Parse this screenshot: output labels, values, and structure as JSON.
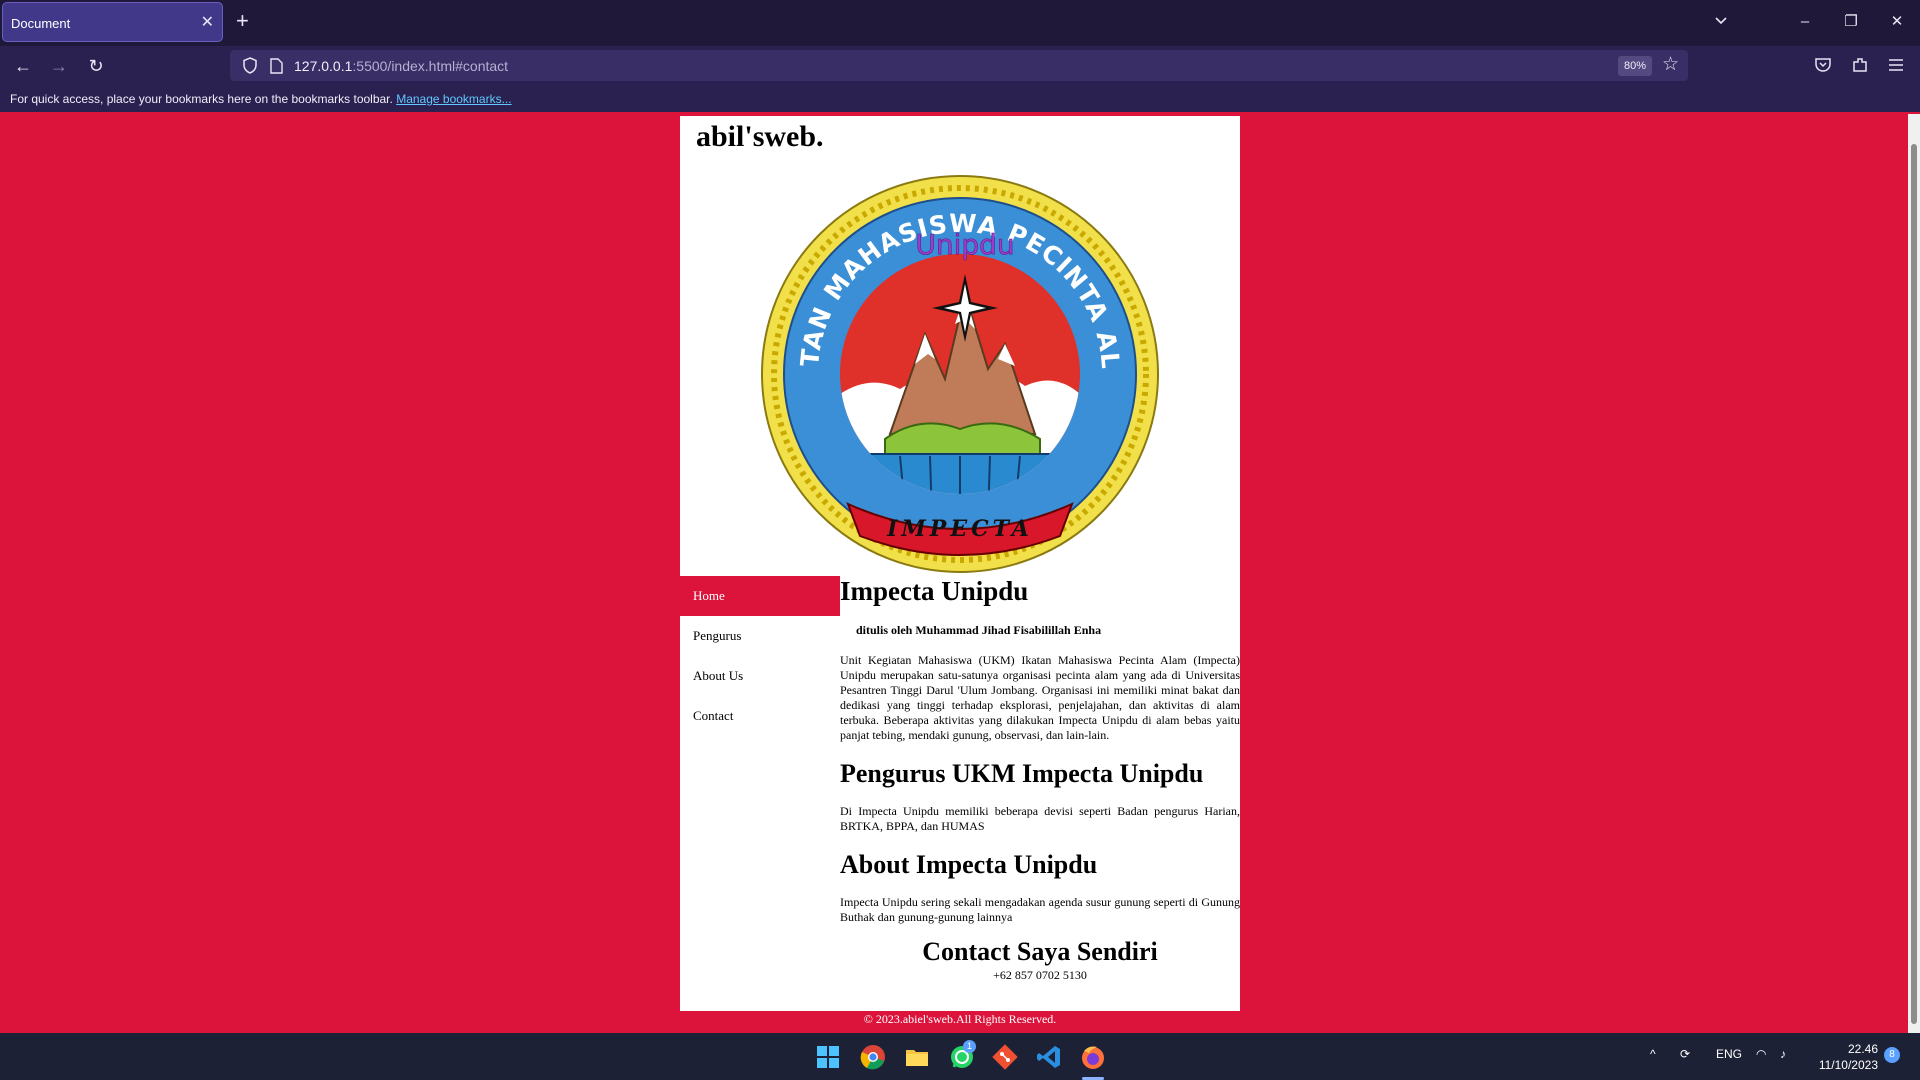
{
  "browser": {
    "tab_title": "Document",
    "tab_close_glyph": "✕",
    "new_tab_glyph": "+",
    "url_host": "127.0.0.1",
    "url_rest": ":5500/index.html#contact",
    "zoom": "80%",
    "bookmarks_text": "For quick access, place your bookmarks here on the bookmarks toolbar.",
    "bookmarks_link": "Manage bookmarks...",
    "icons": [
      "chevron-down-icon",
      "minimize-icon",
      "restore-icon",
      "close-icon",
      "back-icon",
      "forward-icon",
      "reload-icon",
      "shield-icon",
      "page-icon",
      "star-icon",
      "pocket-icon",
      "extensions-icon",
      "menu-icon"
    ]
  },
  "site": {
    "brand": "abil'sweb.",
    "logo": {
      "ring_text": "IKATAN MAHASISWA PECINTA ALAM",
      "subtitle": "Unipdu",
      "banner": "IMPECTA"
    },
    "nav": [
      {
        "label": "Home",
        "active": true
      },
      {
        "label": "Pengurus",
        "active": false
      },
      {
        "label": "About Us",
        "active": false
      },
      {
        "label": "Contact",
        "active": false
      }
    ],
    "section1": {
      "title": "Impecta Unipdu",
      "byline": "ditulis oleh Muhammad Jihad Fisabilillah Enha",
      "body": "Unit Kegiatan Mahasiswa (UKM) Ikatan Mahasiswa Pecinta Alam (Impecta) Unipdu merupakan satu-satunya organisasi pecinta alam yang ada di Universitas Pesantren Tinggi Darul 'Ulum Jombang. Organisasi ini memiliki minat bakat dan dedikasi yang tinggi terhadap eksplorasi, penjelajahan, dan aktivitas di alam terbuka. Beberapa aktivitas yang dilakukan Impecta Unipdu di alam bebas yaitu panjat tebing, mendaki gunung, observasi, dan lain-lain."
    },
    "section2": {
      "title": "Pengurus UKM Impecta Unipdu",
      "body": "Di Impecta Unipdu memiliki beberapa devisi seperti Badan pengurus Harian, BRTKA, BPPA, dan HUMAS"
    },
    "section3": {
      "title": "About Impecta Unipdu",
      "body": "Impecta Unipdu sering sekali mengadakan agenda susur gunung seperti di Gunung Buthak dan gunung-gunung lainnya"
    },
    "contact": {
      "title": "Contact Saya Sendiri",
      "phone": "+62 857 0702 5130"
    },
    "footer": "© 2023.abiel'sweb.All Rights Reserved.",
    "colors": {
      "background": "#dc143c",
      "active_nav": "#dc143c"
    }
  },
  "taskbar": {
    "apps": [
      "windows-start-icon",
      "chrome-icon",
      "file-explorer-icon",
      "whatsapp-icon",
      "git-icon",
      "vscode-icon",
      "firefox-icon"
    ],
    "whatsapp_badge": "1",
    "language": "ENG",
    "time": "22.46",
    "date": "11/10/2023",
    "notifications": "8"
  }
}
